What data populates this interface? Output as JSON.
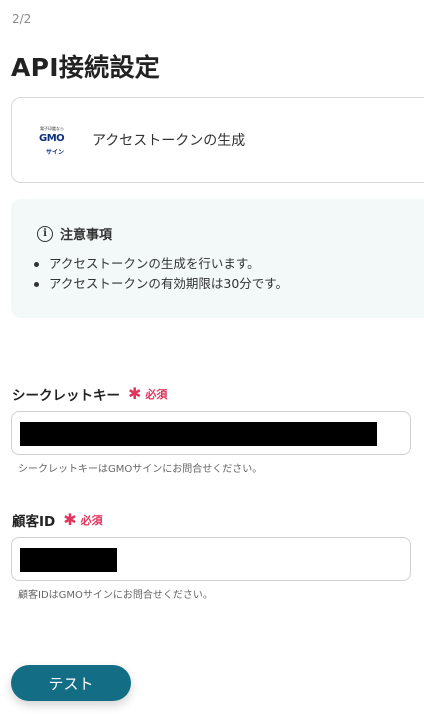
{
  "step_indicator": "2/2",
  "page_title": "API接続設定",
  "app": {
    "logo_tagline": "電子印鑑なら",
    "logo_brand": "GMO",
    "logo_sub": "サイン",
    "action_label": "アクセストークンの生成"
  },
  "notice": {
    "title": "注意事項",
    "icon": "info-circle-icon",
    "items": [
      "アクセストークンの生成を行います。",
      "アクセストークンの有効期限は30分です。"
    ]
  },
  "fields": [
    {
      "label": "シークレットキー",
      "required_mark": "✱",
      "required_text": "必須",
      "value_redacted": true,
      "hint": "シークレットキーはGMOサインにお問合せください。"
    },
    {
      "label": "顧客ID",
      "required_mark": "✱",
      "required_text": "必須",
      "value_redacted": true,
      "hint": "顧客IDはGMOサインにお問合せください。"
    }
  ],
  "actions": {
    "test_label": "テスト"
  },
  "colors": {
    "accent": "#136d85",
    "required": "#e0365c",
    "notice_bg": "#f2f9f8",
    "gmo_brand": "#0b2f7a"
  }
}
